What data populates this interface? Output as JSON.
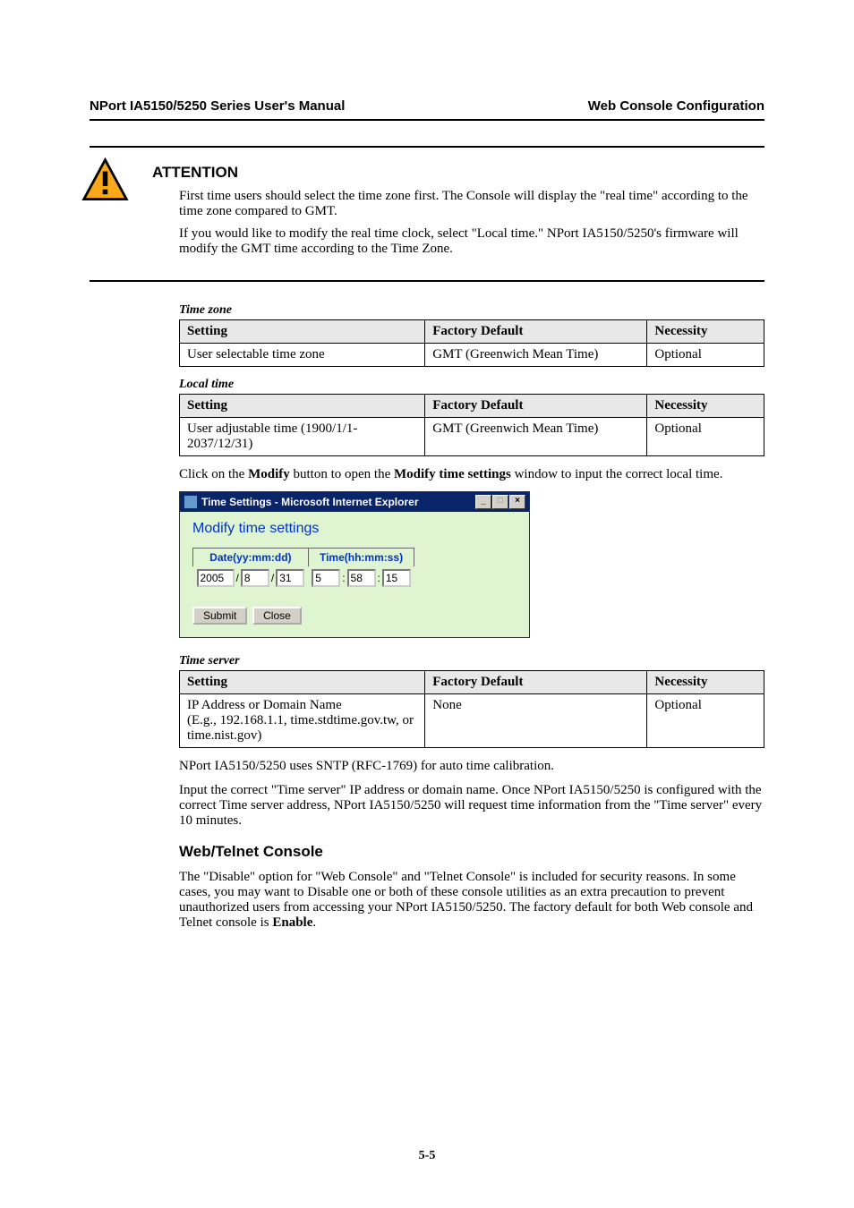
{
  "header": {
    "left": "NPort IA5150/5250 Series User's Manual",
    "right": "Web Console Configuration"
  },
  "attention": {
    "title": "ATTENTION",
    "p1": "First time users should select the time zone first. The Console will display the \"real time\" according to the time zone compared to GMT.",
    "p2": "If you would like to modify the real time clock, select \"Local time.\" NPort IA5150/5250's firmware will modify the GMT time according to the Time Zone."
  },
  "tables": {
    "cols": {
      "c1": "Setting",
      "c2": "Factory Default",
      "c3": "Necessity"
    },
    "timezone": {
      "caption": "Time zone",
      "row": {
        "setting": "User selectable time zone",
        "default": "GMT (Greenwich Mean Time)",
        "necessity": "Optional"
      }
    },
    "localtime": {
      "caption": "Local time",
      "row": {
        "setting": "User adjustable time (1900/1/1-2037/12/31)",
        "default": "GMT (Greenwich Mean Time)",
        "necessity": "Optional"
      }
    },
    "timeserver": {
      "caption": "Time server",
      "row": {
        "setting_line1": "IP Address or Domain Name",
        "setting_line2": "(E.g., 192.168.1.1, time.stdtime.gov.tw, or time.nist.gov)",
        "default": "None",
        "necessity": "Optional"
      }
    }
  },
  "para_modify_a": "Click on the ",
  "para_modify_b": "Modify",
  "para_modify_c": " button to open the ",
  "para_modify_d": "Modify time settings",
  "para_modify_e": " window to input the correct local time.",
  "screenshot": {
    "title": "Time Settings - Microsoft Internet Explorer",
    "heading": "Modify time settings",
    "date_label": "Date(yy:mm:dd)",
    "time_label": "Time(hh:mm:ss)",
    "date": {
      "y": "2005",
      "m": "8",
      "d": "31"
    },
    "time": {
      "h": "5",
      "m": "58",
      "s": "15"
    },
    "submit": "Submit",
    "close": "Close"
  },
  "para_sntp": "NPort IA5150/5250 uses SNTP (RFC-1769) for auto time calibration.",
  "para_timeserver": "Input the correct \"Time server\" IP address or domain name. Once NPort IA5150/5250 is configured with the correct Time server address, NPort IA5150/5250 will request time information from the \"Time server\" every 10 minutes.",
  "subhead": "Web/Telnet Console",
  "para_console_a": "The \"Disable\" option for \"Web Console\" and \"Telnet Console\" is included for security reasons. In some cases, you may want to Disable one or both of these console utilities as an extra precaution to prevent unauthorized users from accessing your NPort IA5150/5250. The factory default for both Web console and Telnet console is ",
  "para_console_b": "Enable",
  "para_console_c": ".",
  "pagenum": "5-5"
}
